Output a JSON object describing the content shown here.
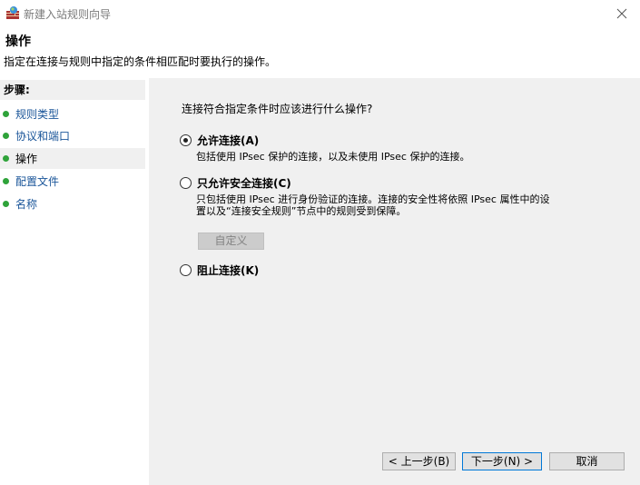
{
  "window": {
    "title": "新建入站规则向导",
    "close_glyph": "✕"
  },
  "header": {
    "title": "操作",
    "description": "指定在连接与规则中指定的条件相匹配时要执行的操作。"
  },
  "sidebar": {
    "heading": "步骤:",
    "items": [
      {
        "label": "规则类型"
      },
      {
        "label": "协议和端口"
      },
      {
        "label": "操作"
      },
      {
        "label": "配置文件"
      },
      {
        "label": "名称"
      }
    ]
  },
  "main": {
    "question": "连接符合指定条件时应该进行什么操作?",
    "options": [
      {
        "label": "允许连接(A)",
        "description": "包括使用 IPsec 保护的连接，以及未使用 IPsec 保护的连接。",
        "checked": true
      },
      {
        "label": "只允许安全连接(C)",
        "description_line1": "只包括使用 IPsec 进行身份验证的连接。连接的安全性将依照 IPsec 属性中的设",
        "description_line2": "置以及“连接安全规则”节点中的规则受到保障。",
        "checked": false
      },
      {
        "label": "阻止连接(K)",
        "checked": false
      }
    ],
    "customize_button": "自定义"
  },
  "footer": {
    "back_button": "< 上一步(B)",
    "next_button": "下一步(N) >",
    "cancel_button": "取消"
  },
  "colors": {
    "step_dot": "#2fa33a",
    "link": "#1a5599",
    "panel_bg": "#f0f0f0",
    "focus_border": "#0078d7"
  }
}
